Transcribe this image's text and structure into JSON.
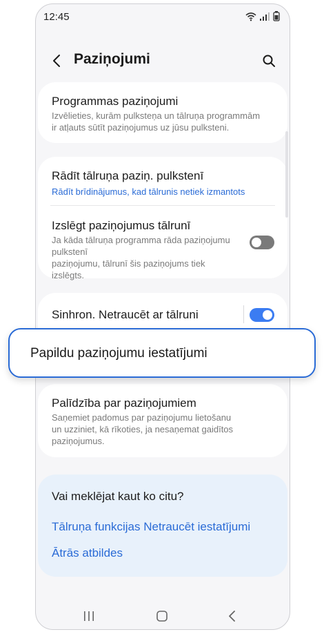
{
  "status_bar": {
    "time": "12:45"
  },
  "header": {
    "title": "Paziņojumi"
  },
  "cards": {
    "app_notifications": {
      "title": "Programmas paziņojumi",
      "desc_line1": "Izvēlieties, kurām pulksteņa un tālruņa programmām",
      "desc_line2": "ir atļauts sūtīt paziņojumus uz jūsu pulksteni."
    },
    "show_phone": {
      "title": "Rādīt tālruņa paziņ. pulkstenī",
      "subtitle": "Rādīt brīdinājumus, kad tālrunis netiek izmantots"
    },
    "mute_phone": {
      "title": "Izslēgt paziņojumus tālrunī",
      "desc_line1": "Ja kāda tālruņa programma rāda paziņojumu pulkstenī",
      "desc_line2": "paziņojumu, tālrunī šis paziņojums tiek",
      "desc_line3": "izslēgts.",
      "toggle_state": "off"
    },
    "sync_dnd": {
      "title": "Sinhron. Netraucēt ar tālruni",
      "toggle_state": "on"
    },
    "advanced": {
      "title": "Papildu paziņojumu iestatījumi"
    },
    "help": {
      "title": "Palīdzība par paziņojumiem",
      "desc_line1": "Saņemiet padomus par paziņojumu lietošanu",
      "desc_line2": "un uzziniet, kā rīkoties, ja nesaņemat gaidītos",
      "desc_line3": "paziņojumus."
    }
  },
  "suggestions": {
    "title": "Vai meklējat kaut ko citu?",
    "links": [
      "Tālruņa funkcijas Netraucēt iestatījumi",
      "Ātrās atbildes"
    ]
  },
  "colors": {
    "accent": "#2a6bd6",
    "toggle_on": "#3b7cf2",
    "toggle_off": "#7a7a7a"
  }
}
